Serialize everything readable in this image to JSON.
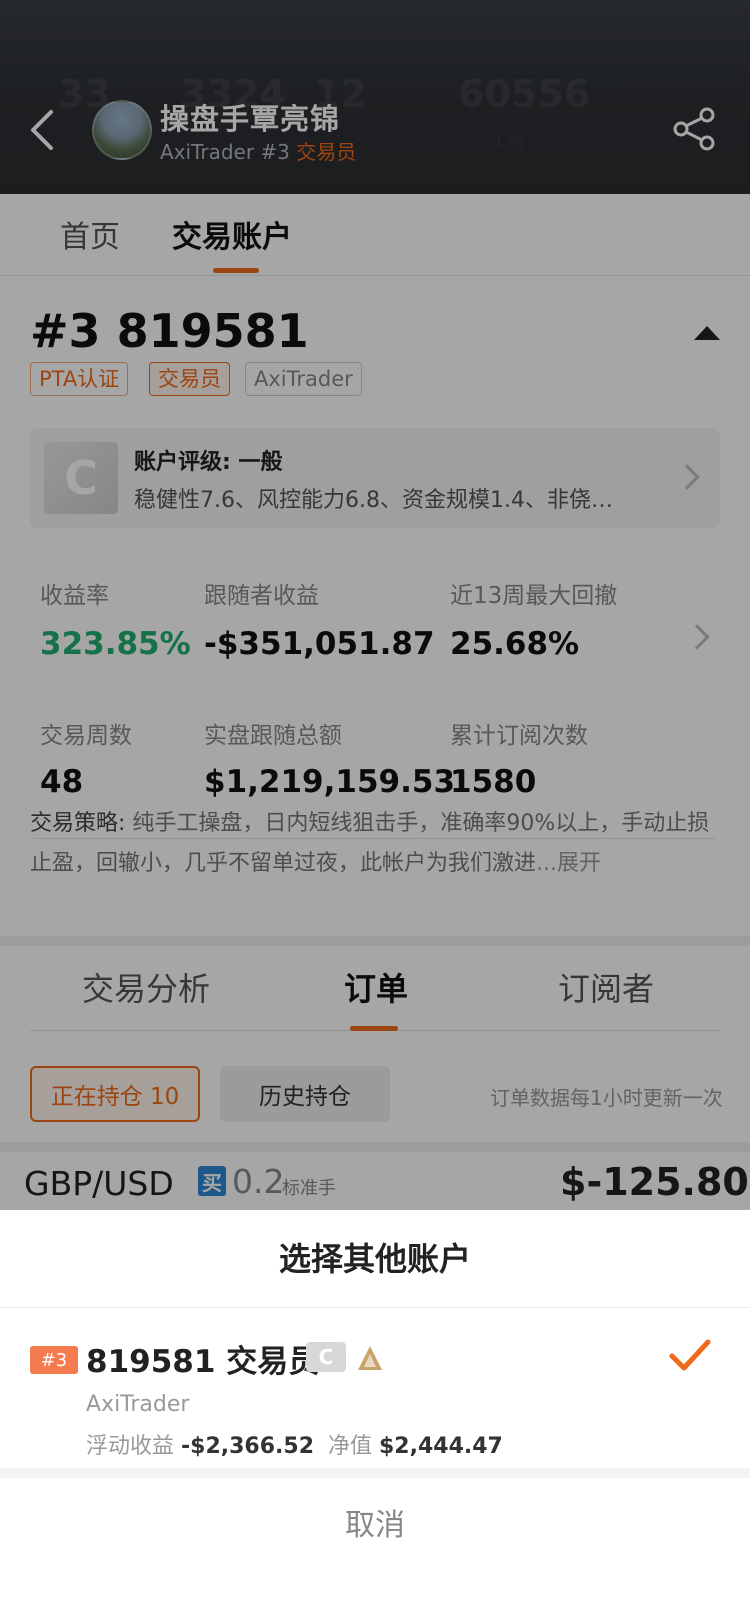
{
  "header": {
    "name": "操盘手覃亮锦",
    "broker": "AxiTrader #3 ",
    "role": "交易员",
    "ghost_stats": [
      "33",
      "3324",
      "12",
      "60556"
    ],
    "ghost_labels": [
      "",
      "",
      "",
      "人气"
    ]
  },
  "top_tabs": [
    {
      "label": "首页",
      "active": false
    },
    {
      "label": "交易账户",
      "active": true
    }
  ],
  "account": {
    "title": "#3 819581",
    "tags": [
      "PTA认证",
      "交易员",
      "AxiTrader"
    ],
    "rating": {
      "badge": "C",
      "title": "账户评级: 一般",
      "desc": "稳健性7.6、风控能力6.8、资金规模1.4、非侥…"
    },
    "stats": [
      {
        "label": "收益率",
        "value": "323.85%"
      },
      {
        "label": "跟随者收益",
        "value": "-$351,051.87"
      },
      {
        "label": "近13周最大回撤",
        "value": "25.68%"
      },
      {
        "label": "交易周数",
        "value": "48"
      },
      {
        "label": "实盘跟随总额",
        "value": "$1,219,159.53"
      },
      {
        "label": "累计订阅次数",
        "value": "1580"
      }
    ],
    "strategy_label": "交易策略: ",
    "strategy_text": "纯手工操盘，日内短线狙击手，准确率90%以上，手动止损止盈，回辙小，几乎不留单过夜，此帐户为我们激进",
    "strategy_more": "...展开"
  },
  "sub_tabs": [
    {
      "label": "交易分析",
      "active": false
    },
    {
      "label": "订单",
      "active": true
    },
    {
      "label": "订阅者",
      "active": false
    }
  ],
  "positions": {
    "open_label": "正在持仓 10",
    "history_label": "历史持仓",
    "update_note": "订单数据每1小时更新一次"
  },
  "order": {
    "pair": "GBP/USD",
    "side": "买",
    "lot": "0.2",
    "lot_unit": "标准手",
    "pnl": "$-125.80"
  },
  "sheet": {
    "title": "选择其他账户",
    "account": {
      "num": "#3",
      "line": "819581 交易员",
      "grade": "C",
      "broker": "AxiTrader",
      "float_label": "浮动收益 ",
      "float_value": "-$2,366.52",
      "equity_label": "  净值 ",
      "equity_value": "$2,444.47"
    },
    "cancel": "取消"
  },
  "colors": {
    "accent": "#f06a1c",
    "green": "#1fae6f",
    "buy": "#2f88d6"
  }
}
